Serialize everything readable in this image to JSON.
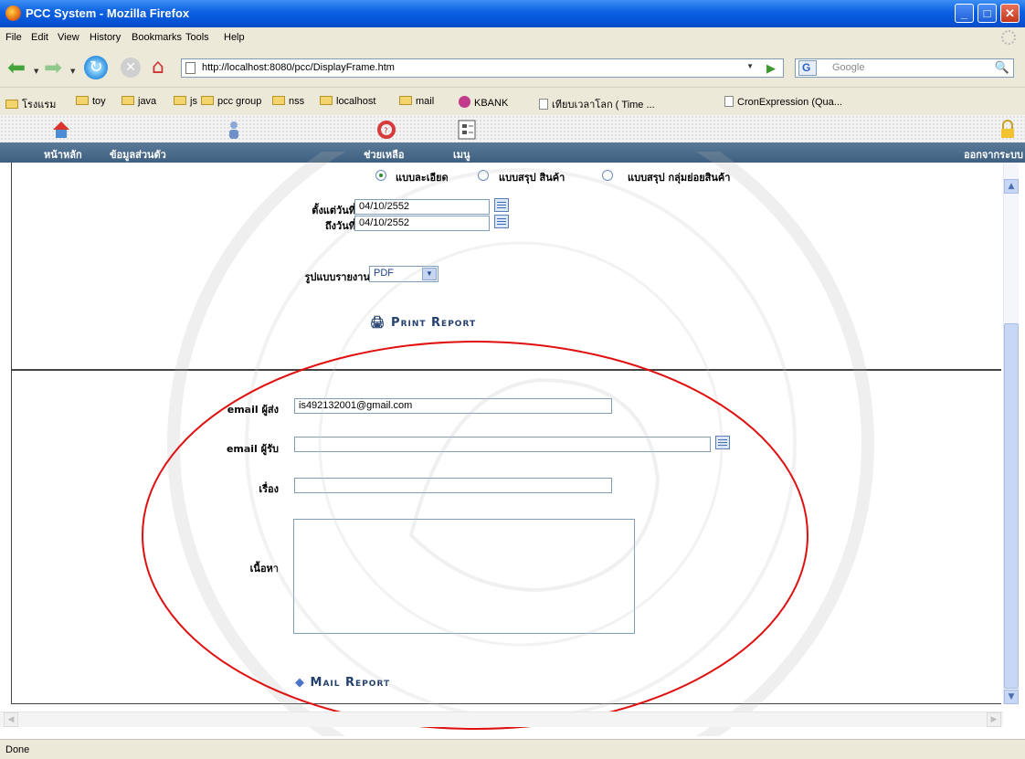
{
  "window": {
    "title": "PCC System - Mozilla Firefox",
    "buttons": {
      "minimize": "_",
      "maximize": "□",
      "close": "✕"
    }
  },
  "menu": [
    "File",
    "Edit",
    "View",
    "History",
    "Bookmarks",
    "Tools",
    "Help"
  ],
  "navigation": {
    "url": "http://localhost:8080/pcc/DisplayFrame.htm",
    "search_engine": "G",
    "search_placeholder": "Google"
  },
  "bookmarks": [
    "โรงแรม",
    "toy",
    "java",
    "js",
    "pcc group",
    "nss",
    "localhost",
    "mail",
    "KBANK",
    "เทียบเวลาโลก ( Time ...",
    "CronExpression (Qua..."
  ],
  "app_nav": {
    "home": "หน้าหลัก",
    "profile": "ข้อมูลส่วนตัว",
    "help": "ช่วยเหลือ",
    "menu": "เมนู",
    "logout": "ออกจากระบบ"
  },
  "report_options": {
    "detailed": "แบบละเอียด",
    "summary_product": "แบบสรุป สินค้า",
    "summary_subgroup": "แบบสรุป กลุ่มย่อยสินค้า",
    "selected": "detailed"
  },
  "date_range": {
    "from_label": "ตั้งแต่วันที่",
    "from_value": "04/10/2552",
    "to_label": "ถึงวันที่",
    "to_value": "04/10/2552"
  },
  "format": {
    "label": "รูปแบบรายงาน",
    "selected": "PDF"
  },
  "print_button": "Print Report",
  "mail": {
    "sender_label": "email ผู้ส่ง",
    "sender_value": "is492132001@gmail.com",
    "recipient_label": "email ผู้รับ",
    "recipient_value": "",
    "subject_label": "เรื่อง",
    "subject_value": "",
    "body_label": "เนื้อหา",
    "body_value": "",
    "mail_button": "Mail Report"
  },
  "status": "Done",
  "colors": {
    "app_nav_bg": "#4a6a8a",
    "annotation_ellipse": "#e01010",
    "button_text": "#23406e"
  }
}
